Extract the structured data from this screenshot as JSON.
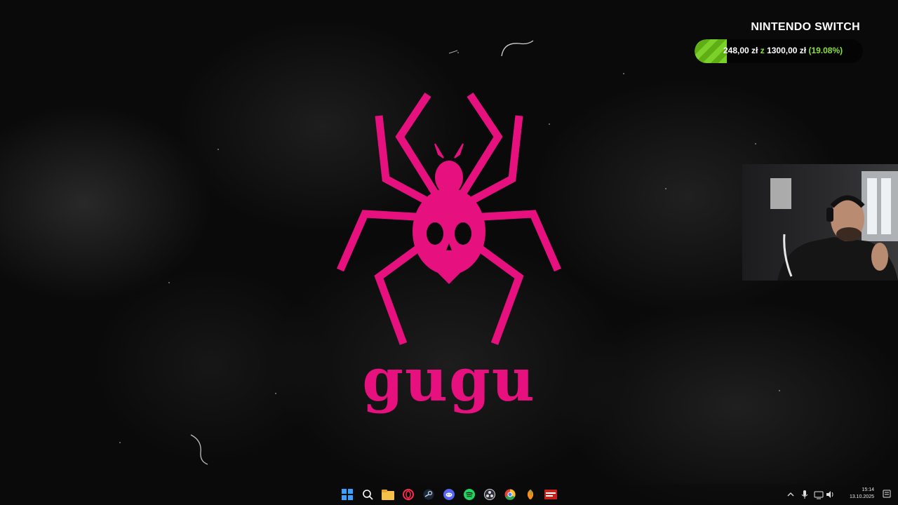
{
  "goal": {
    "title": "NINTENDO SWITCH",
    "current": "248,00 zł",
    "separator": "z",
    "target": "1300,00 zł",
    "percent_text": "(19.08%)",
    "progress": 0.1908,
    "colors": {
      "fill": "#7bd12a",
      "highlight": "#8de03a"
    }
  },
  "desktop": {
    "logo_text": "gugu",
    "logo_icon": "spider-skull-icon",
    "colors": {
      "logo": "#e6117e",
      "background": "#0a0a0a"
    }
  },
  "webcam": {
    "description_icon": "webcam-feed"
  },
  "taskbar": {
    "icons": [
      {
        "name": "windows-start-icon"
      },
      {
        "name": "search-icon"
      },
      {
        "name": "file-explorer-icon"
      },
      {
        "name": "opera-gx-icon"
      },
      {
        "name": "steam-icon"
      },
      {
        "name": "discord-icon"
      },
      {
        "name": "spotify-icon"
      },
      {
        "name": "obs-icon"
      },
      {
        "name": "chrome-icon"
      },
      {
        "name": "fl-studio-icon"
      },
      {
        "name": "voicemod-icon"
      }
    ],
    "tray": {
      "icons": [
        "chevron-up-icon",
        "microphone-icon",
        "network-icon",
        "speaker-icon"
      ],
      "time": "15:14",
      "date": "13.10.2025"
    }
  }
}
